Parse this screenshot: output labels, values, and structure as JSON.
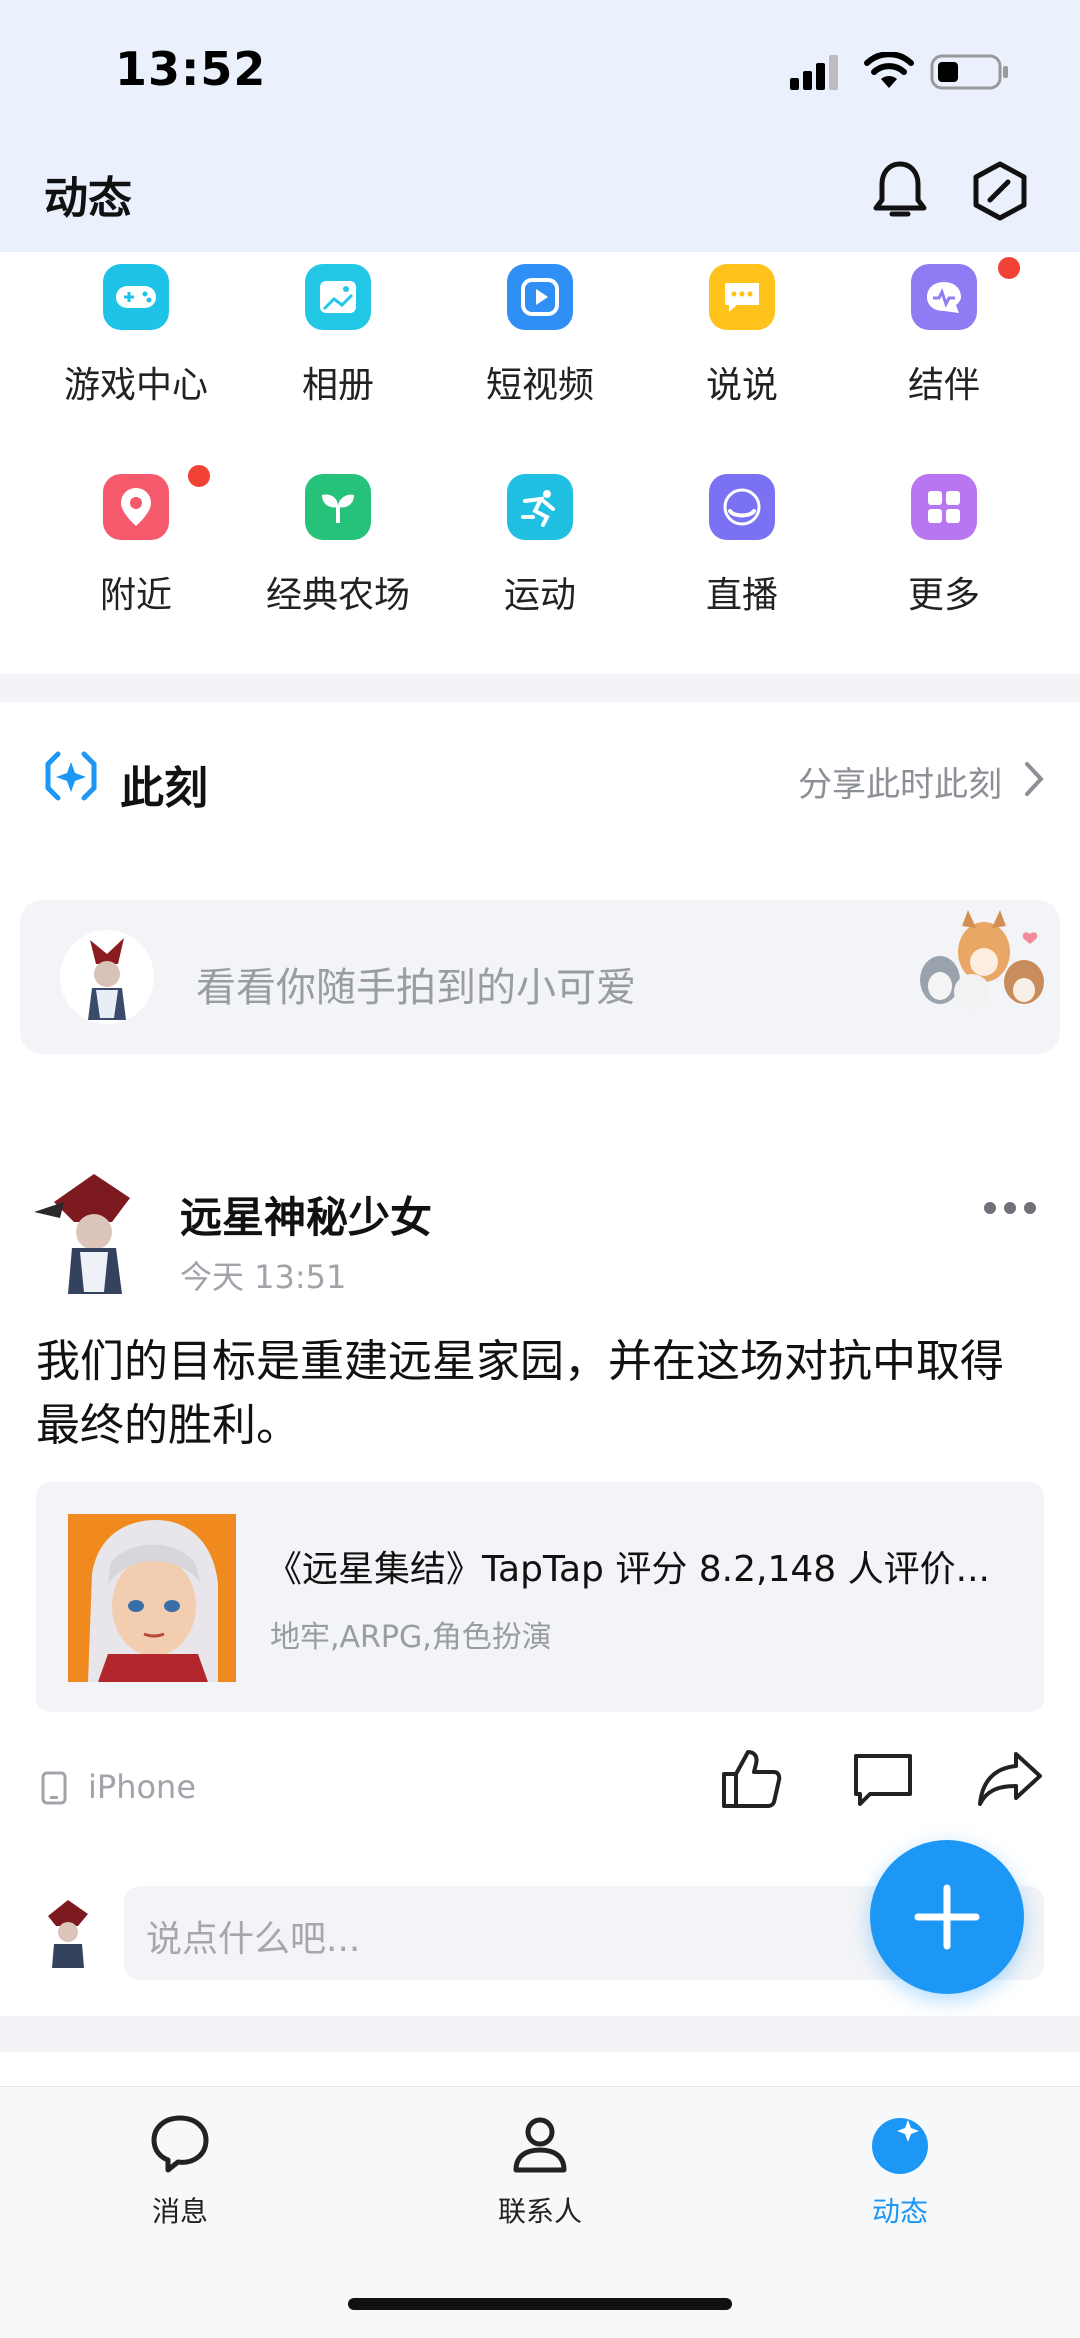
{
  "status_bar": {
    "time": "13:52"
  },
  "header": {
    "title": "动态"
  },
  "shortcuts": [
    {
      "label": "游戏中心",
      "icon": "gamepad-icon",
      "color": "#1fc3e8",
      "badge": false
    },
    {
      "label": "相册",
      "icon": "photo-album-icon",
      "color": "#22c7e6",
      "badge": false
    },
    {
      "label": "短视频",
      "icon": "short-video-icon",
      "color": "#2f8ff5",
      "badge": false
    },
    {
      "label": "说说",
      "icon": "speech-bubble-icon",
      "color": "#ffc21a",
      "badge": false
    },
    {
      "label": "结伴",
      "icon": "companion-icon",
      "color": "#8f7cf4",
      "badge": true
    },
    {
      "label": "附近",
      "icon": "location-pin-icon",
      "color": "#f45a6b",
      "badge": true
    },
    {
      "label": "经典农场",
      "icon": "sprout-icon",
      "color": "#27c27a",
      "badge": false
    },
    {
      "label": "运动",
      "icon": "running-icon",
      "color": "#20c0e3",
      "badge": false
    },
    {
      "label": "直播",
      "icon": "live-icon",
      "color": "#7b72f3",
      "badge": false
    },
    {
      "label": "更多",
      "icon": "more-grid-icon",
      "color": "#b876f0",
      "badge": false
    }
  ],
  "moment": {
    "title": "此刻",
    "share_label": "分享此时此刻",
    "composer_placeholder": "看看你随手拍到的小可爱"
  },
  "post": {
    "username": "远星神秘少女",
    "time": "今天 13:51",
    "text": "我们的目标是重建远星家园，并在这场对抗中取得最终的胜利。",
    "card_title": "《远星集结》TapTap 评分 8.2,148 人评价...",
    "card_tags": "地牢,ARPG,角色扮演",
    "device": "iPhone",
    "comment_placeholder": "说点什么吧..."
  },
  "tabs": [
    {
      "label": "消息",
      "icon": "message-icon",
      "active": false
    },
    {
      "label": "联系人",
      "icon": "contacts-icon",
      "active": false
    },
    {
      "label": "动态",
      "icon": "feed-star-icon",
      "active": true
    }
  ],
  "colors": {
    "accent": "#1c97f5",
    "badge": "#f24235",
    "header_bg": "#eaf1fd"
  }
}
